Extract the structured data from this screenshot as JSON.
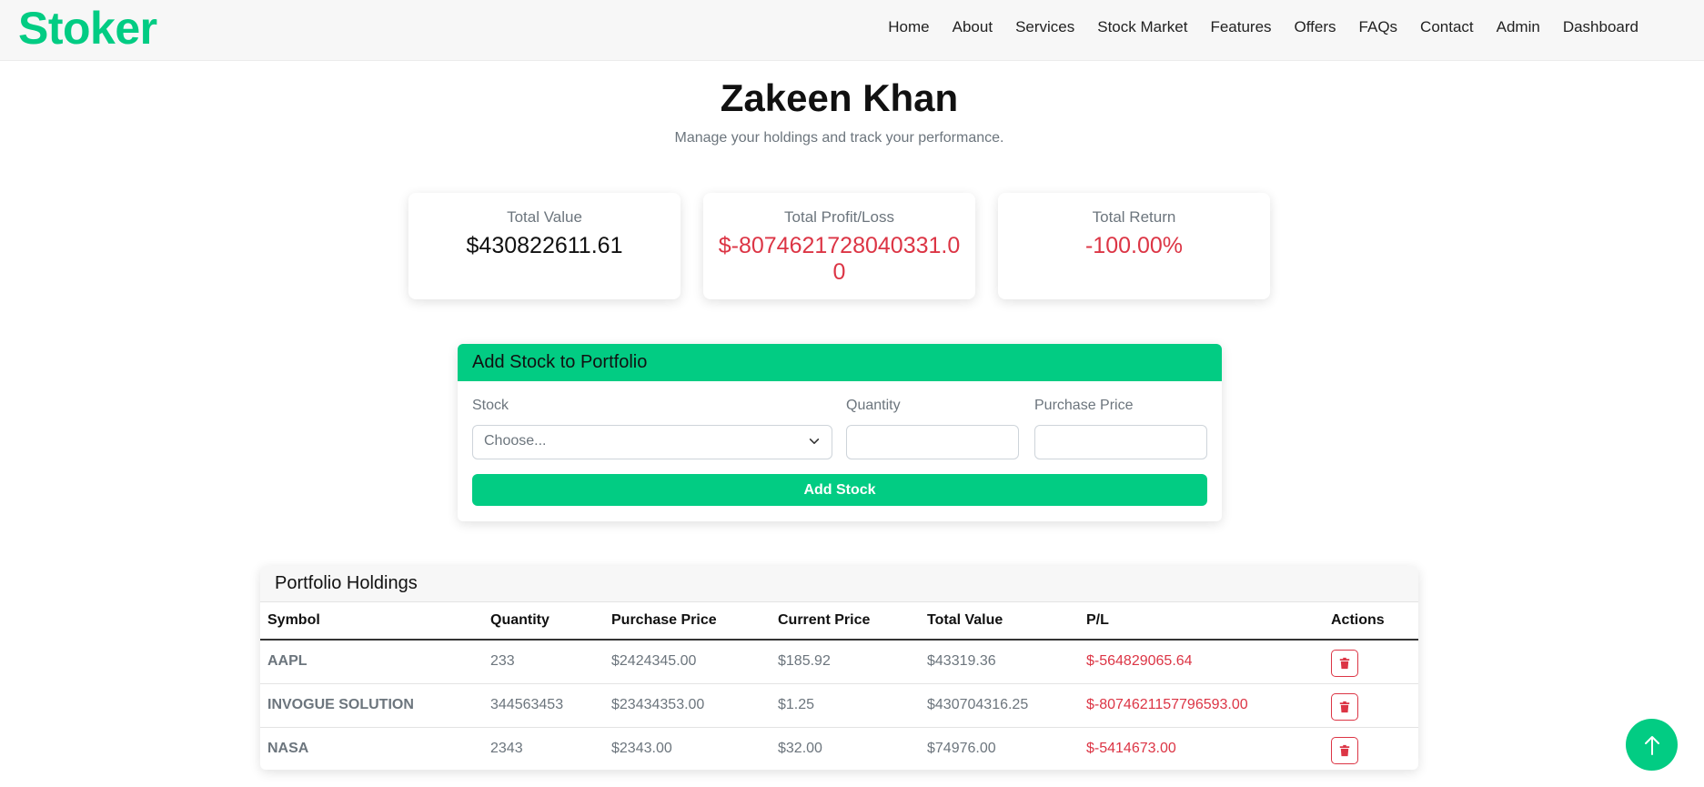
{
  "brand": "Stoker",
  "nav": [
    "Home",
    "About",
    "Services",
    "Stock Market",
    "Features",
    "Offers",
    "FAQs",
    "Contact",
    "Admin",
    "Dashboard"
  ],
  "profile": {
    "name": "Zakeen Khan",
    "subtitle": "Manage your holdings and track your performance."
  },
  "summary": {
    "total_value_label": "Total Value",
    "total_value": "$430822611.61",
    "total_pl_label": "Total Profit/Loss",
    "total_pl": "$-8074621728040331.00",
    "total_return_label": "Total Return",
    "total_return": "-100.00%"
  },
  "form": {
    "title": "Add Stock to Portfolio",
    "stock_label": "Stock",
    "stock_placeholder": "Choose...",
    "quantity_label": "Quantity",
    "quantity_value": "",
    "price_label": "Purchase Price",
    "price_value": "",
    "submit_label": "Add Stock"
  },
  "holdings": {
    "title": "Portfolio Holdings",
    "columns": [
      "Symbol",
      "Quantity",
      "Purchase Price",
      "Current Price",
      "Total Value",
      "P/L",
      "Actions"
    ],
    "rows": [
      {
        "symbol": "AAPL",
        "quantity": "233",
        "purchase_price": "$2424345.00",
        "current_price": "$185.92",
        "total_value": "$43319.36",
        "pl": "$-564829065.64"
      },
      {
        "symbol": "INVOGUE SOLUTION",
        "quantity": "344563453",
        "purchase_price": "$23434353.00",
        "current_price": "$1.25",
        "total_value": "$430704316.25",
        "pl": "$-8074621157796593.00"
      },
      {
        "symbol": "NASA",
        "quantity": "2343",
        "purchase_price": "$2343.00",
        "current_price": "$32.00",
        "total_value": "$74976.00",
        "pl": "$-5414673.00"
      }
    ]
  },
  "icons": {
    "select_chevron": "chevron-down-icon",
    "delete": "trash-icon",
    "scroll_top": "arrow-up-icon"
  },
  "colors": {
    "brand": "#02cc83",
    "negative": "#dc3545"
  }
}
